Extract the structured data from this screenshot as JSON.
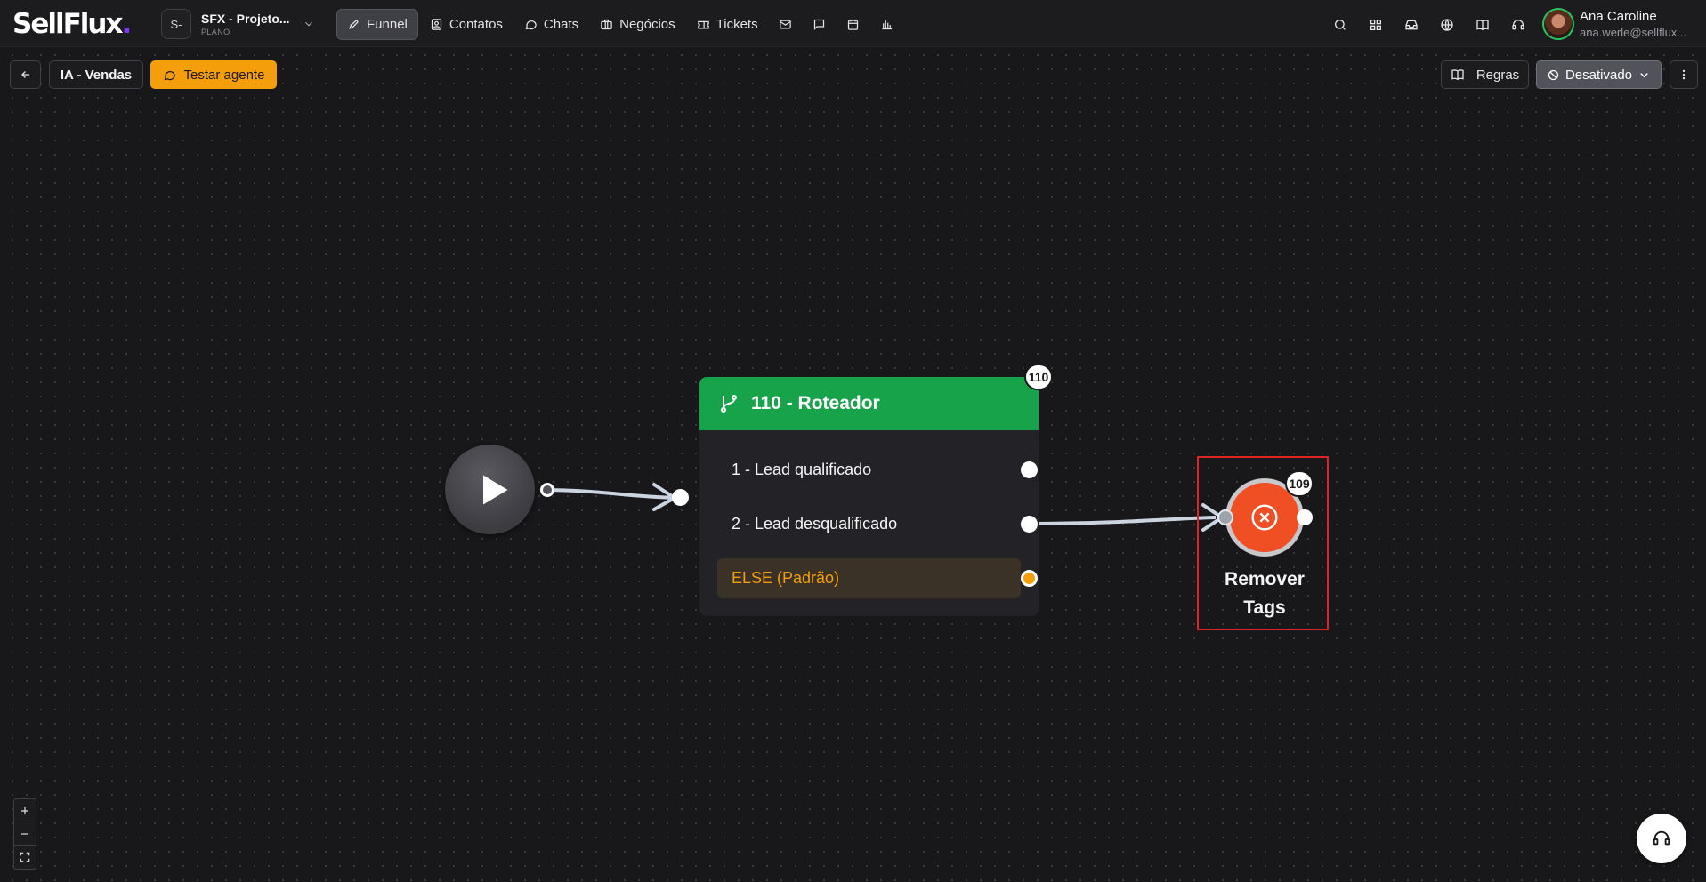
{
  "brand": {
    "logo_text": "SellFlux",
    "logo_dot": "."
  },
  "project": {
    "initials": "S-",
    "name": "SFX - Projeto...",
    "plan": "PLANO"
  },
  "nav": {
    "items": [
      {
        "label": "Funnel",
        "icon": "rocket-icon",
        "active": true
      },
      {
        "label": "Contatos",
        "icon": "contacts-icon"
      },
      {
        "label": "Chats",
        "icon": "chat-icon"
      },
      {
        "label": "Negócios",
        "icon": "briefcase-icon"
      },
      {
        "label": "Tickets",
        "icon": "ticket-icon"
      }
    ],
    "icon_items": [
      "mail-icon",
      "message-square-icon",
      "calendar-icon",
      "bar-chart-icon"
    ]
  },
  "header_right": {
    "icons": [
      "search-icon",
      "apps-grid-icon",
      "inbox-icon",
      "globe-icon",
      "book-icon",
      "headset-icon"
    ]
  },
  "user": {
    "name": "Ana Caroline",
    "email": "ana.werle@sellflux..."
  },
  "toolbar": {
    "flow_name": "IA - Vendas",
    "test_label": "Testar agente",
    "rules_label": "Regras",
    "status_label": "Desativado"
  },
  "flow": {
    "router": {
      "badge": "110",
      "title": "110 - Roteador",
      "routes": [
        "1 - Lead qualificado",
        "2 - Lead desqualificado"
      ],
      "else_label": "ELSE (Padrão)"
    },
    "remove_tags": {
      "badge": "109",
      "label_line1": "Remover",
      "label_line2": "Tags"
    }
  },
  "colors": {
    "accent_orange": "#f59e0b",
    "router_green": "#16a34a",
    "remove_node": "#f04e23",
    "selection": "#dc2626",
    "logo_dot": "#7c3aed"
  }
}
